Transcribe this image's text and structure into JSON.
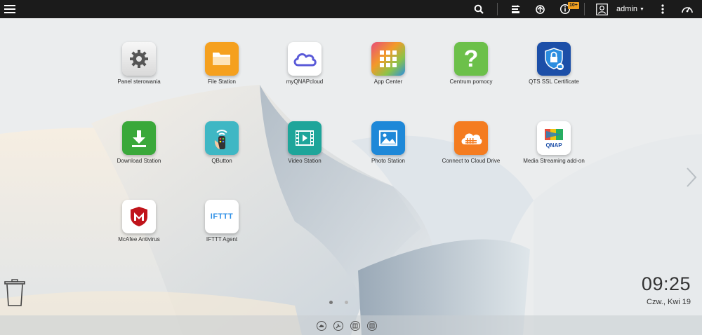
{
  "topbar": {
    "user": "admin",
    "notification_badge": "10+"
  },
  "apps": [
    {
      "label": "Panel sterowania",
      "icon": "gear-icon"
    },
    {
      "label": "File Station",
      "icon": "folder-icon"
    },
    {
      "label": "myQNAPcloud",
      "icon": "cloud-icon"
    },
    {
      "label": "App Center",
      "icon": "app-grid-icon"
    },
    {
      "label": "Centrum pomocy",
      "icon": "question-icon"
    },
    {
      "label": "QTS SSL Certificate",
      "icon": "shield-lock-icon"
    },
    {
      "label": "Download Station",
      "icon": "download-icon"
    },
    {
      "label": "QButton",
      "icon": "remote-icon"
    },
    {
      "label": "Video Station",
      "icon": "film-icon"
    },
    {
      "label": "Photo Station",
      "icon": "picture-icon"
    },
    {
      "label": "Connect to Cloud Drive",
      "icon": "cloud-drive-icon"
    },
    {
      "label": "Media Streaming add-on",
      "icon": "qnap-media-icon"
    },
    {
      "label": "McAfee Antivirus",
      "icon": "mcafee-shield-icon"
    },
    {
      "label": "IFTTT Agent",
      "icon": "ifttt-icon"
    }
  ],
  "ifttt_logo_text": "IFTTT",
  "qnap_logo_text": "QNAP",
  "clock": {
    "time": "09:25",
    "date": "Czw., Kwi 19"
  },
  "colors": {
    "topbar": "#1b1b1b",
    "badge": "#f0a020",
    "file_station": "#f5a01e",
    "download_station": "#3aa83a",
    "video_station": "#1ea59a",
    "photo_station": "#1e88d8",
    "help_center": "#6cc04a",
    "cloud_drive": "#f47c20"
  }
}
